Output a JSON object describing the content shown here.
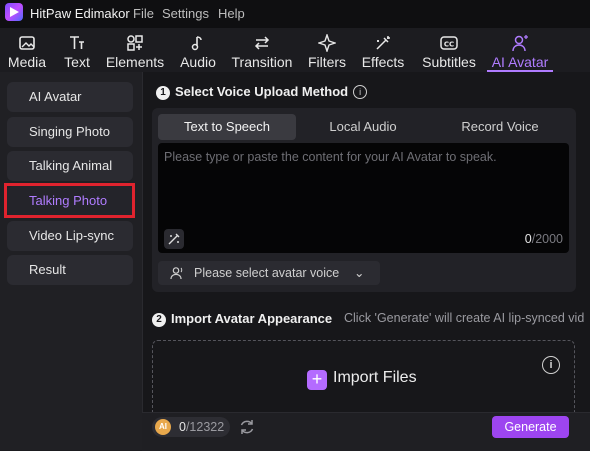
{
  "app": {
    "title": "HitPaw Edimakor"
  },
  "menu": [
    "File",
    "Settings",
    "Help"
  ],
  "toolbar": {
    "items": [
      {
        "label": "Media",
        "icon": "media-icon"
      },
      {
        "label": "Text",
        "icon": "text-icon"
      },
      {
        "label": "Elements",
        "icon": "elements-icon"
      },
      {
        "label": "Audio",
        "icon": "audio-icon"
      },
      {
        "label": "Transition",
        "icon": "transition-icon"
      },
      {
        "label": "Filters",
        "icon": "filters-icon"
      },
      {
        "label": "Effects",
        "icon": "effects-icon"
      },
      {
        "label": "Subtitles",
        "icon": "subtitles-icon"
      },
      {
        "label": "AI Avatar",
        "icon": "ai-avatar-icon"
      }
    ],
    "active": "AI Avatar"
  },
  "sidebar": {
    "items": [
      {
        "label": "AI Avatar"
      },
      {
        "label": "Singing Photo"
      },
      {
        "label": "Talking Animal"
      },
      {
        "label": "Talking Photo"
      },
      {
        "label": "Video Lip-sync"
      },
      {
        "label": "Result"
      }
    ],
    "active": "Talking Photo"
  },
  "step1": {
    "number": "1",
    "title": "Select Voice Upload Method",
    "tabs": [
      "Text to Speech",
      "Local Audio",
      "Record Voice"
    ],
    "active_tab": "Text to Speech",
    "placeholder": "Please type or paste the content for your AI Avatar to speak.",
    "char_current": "0",
    "char_max": "/2000",
    "voice_select": "Please select avatar voice"
  },
  "step2": {
    "number": "2",
    "title": "Import Avatar Appearance",
    "hint": "Click 'Generate' will create AI lip-synced vid",
    "import_label": "Import Files"
  },
  "footer": {
    "coin_label": "AI",
    "credits_used": "0",
    "credits_total": "/12322",
    "generate_label": "Generate"
  },
  "colors": {
    "accent": "#b07cff",
    "generate": "#9d45f0",
    "highlight": "#e0232e"
  }
}
